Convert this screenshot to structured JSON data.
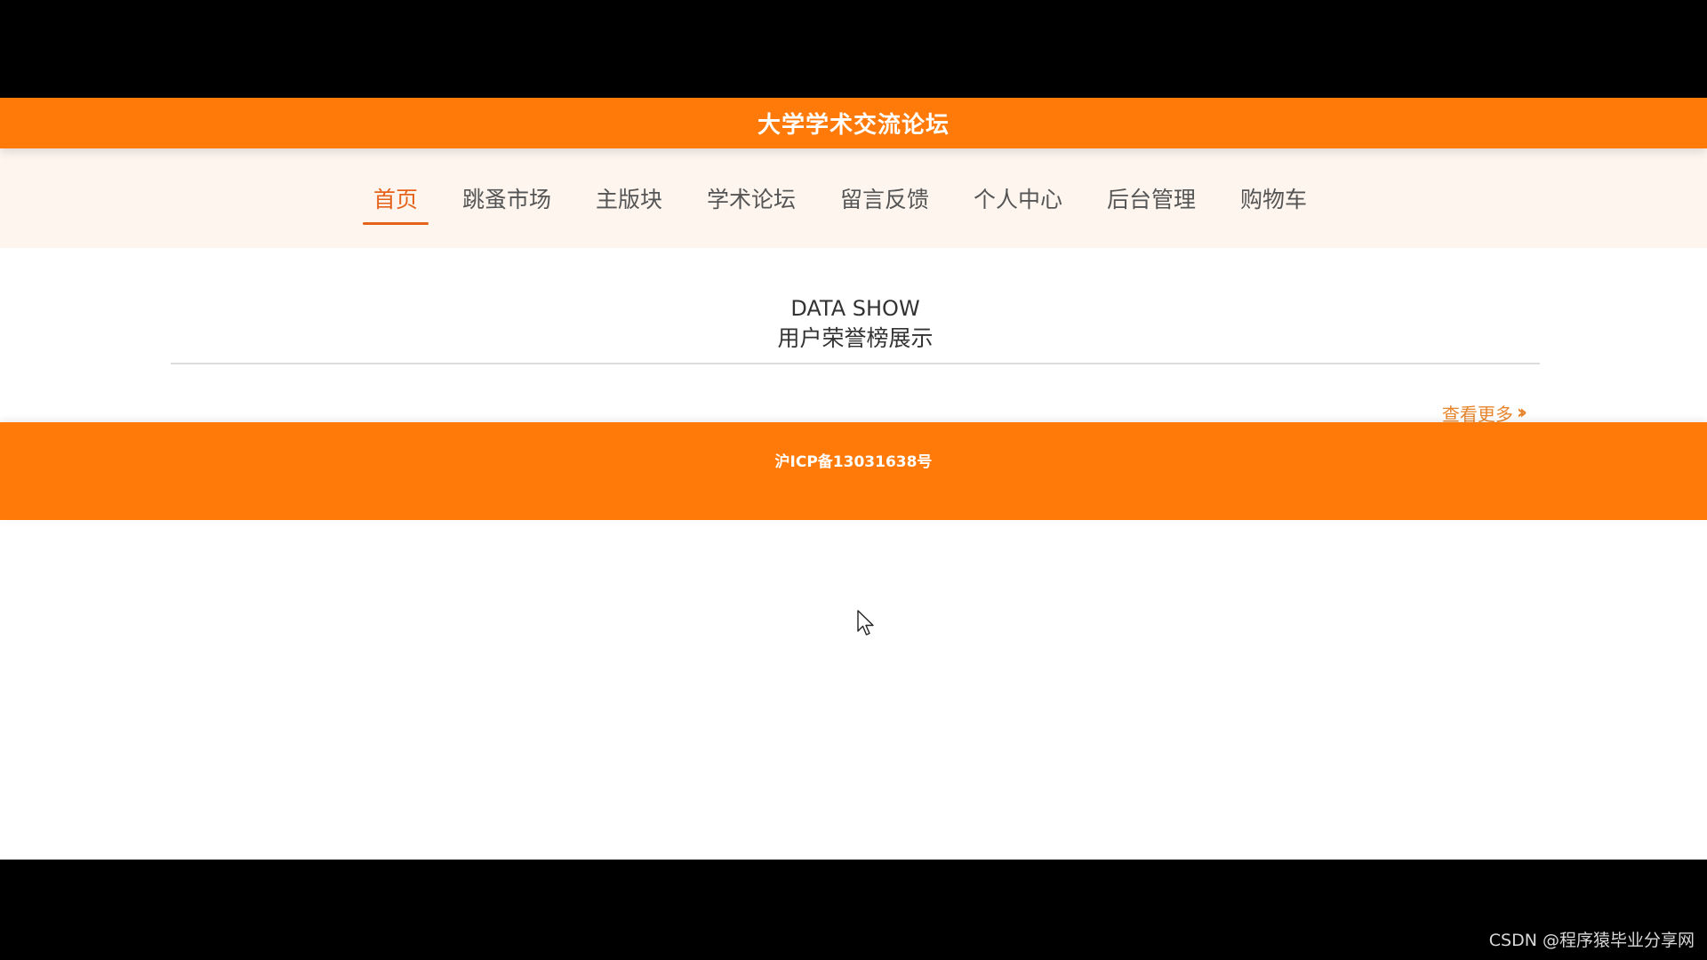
{
  "header": {
    "title": "大学学术交流论坛"
  },
  "nav": {
    "items": [
      {
        "label": "首页",
        "active": true
      },
      {
        "label": "跳蚤市场",
        "active": false
      },
      {
        "label": "主版块",
        "active": false
      },
      {
        "label": "学术论坛",
        "active": false
      },
      {
        "label": "留言反馈",
        "active": false
      },
      {
        "label": "个人中心",
        "active": false
      },
      {
        "label": "后台管理",
        "active": false
      },
      {
        "label": "购物车",
        "active": false
      }
    ]
  },
  "section": {
    "title_en": "DATA SHOW",
    "title_cn": "用户荣誉榜展示",
    "more_label": "查看更多"
  },
  "footer": {
    "icp": "沪ICP备13031638号"
  },
  "watermark": "CSDN @程序猿毕业分享网",
  "colors": {
    "brand_orange": "#ff7a08",
    "nav_bg": "#fdf5ee",
    "active": "#e6621a",
    "more_link": "#e8862e"
  }
}
